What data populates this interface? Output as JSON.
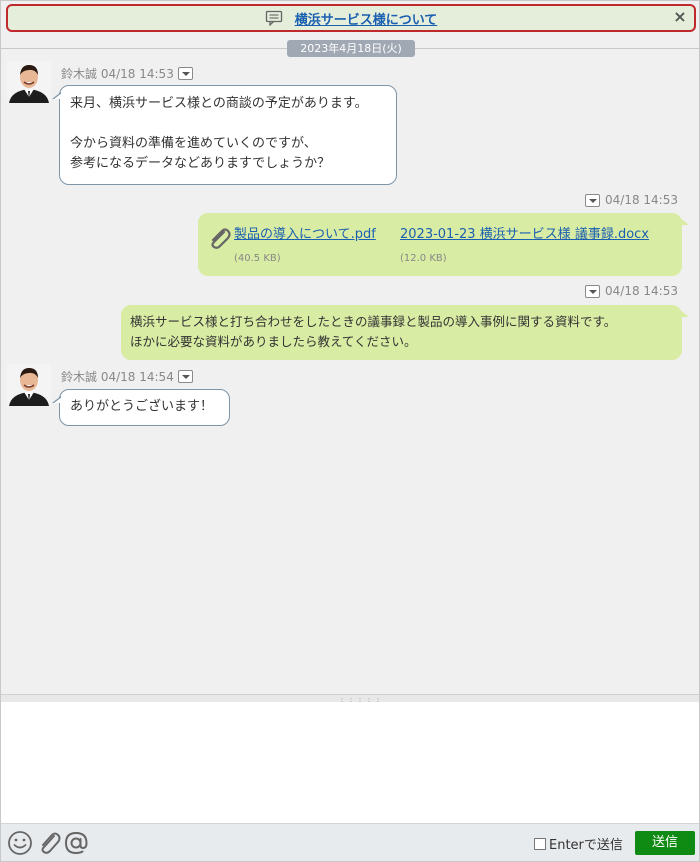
{
  "topic": {
    "title": "横浜サービス様について",
    "close": "×"
  },
  "date_divider": "2023年4月18日(火)",
  "messages": [
    {
      "sender": "鈴木誠",
      "time": "04/18 14:53",
      "lines": [
        "来月、横浜サービス様との商談の予定があります。",
        "",
        "今から資料の準備を進めていくのですが、",
        "参考になるデータなどありますでしょうか？"
      ]
    },
    {
      "time": "04/18 14:53",
      "files": [
        {
          "name": "製品の導入について.pdf",
          "size": "(40.5 KB)"
        },
        {
          "name": "2023-01-23 横浜サービス様 議事録.docx",
          "size": "(12.0 KB)"
        }
      ]
    },
    {
      "time": "04/18 14:53",
      "lines": [
        "横浜サービス様と打ち合わせをしたときの議事録と製品の導入事例に関する資料です。",
        "ほかに必要な資料がありましたら教えてください。"
      ]
    },
    {
      "sender": "鈴木誠",
      "time": "04/18 14:54",
      "lines": [
        "ありがとうございます！"
      ]
    }
  ],
  "composer": {
    "placeholder": "",
    "enter_to_send": "Enterで送信",
    "send_label": "送信"
  },
  "icons": {
    "topic": "topic-icon",
    "emoji": "emoji-icon",
    "attach": "paperclip-icon",
    "mention": "at-icon",
    "dropdown": "chevron-down-icon"
  },
  "colors": {
    "topic_border": "#c0292b",
    "outgoing_bubble": "#d9eca4",
    "send_button": "#0f8a12",
    "link": "#1a5fb0"
  }
}
